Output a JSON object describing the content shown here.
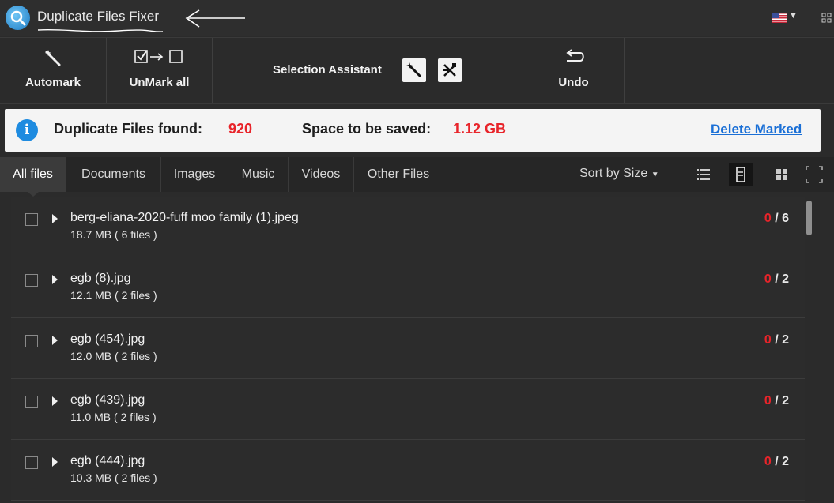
{
  "app": {
    "title": "Duplicate Files Fixer"
  },
  "toolbar": {
    "automark_label": "Automark",
    "unmark_label": "UnMark all",
    "selection_assistant_label": "Selection Assistant",
    "undo_label": "Undo"
  },
  "info": {
    "found_label": "Duplicate Files found:",
    "found_value": "920",
    "space_label": "Space to be saved:",
    "space_value": "1.12 GB",
    "delete_label": "Delete Marked"
  },
  "tabs": [
    {
      "label": "All files",
      "active": true
    },
    {
      "label": "Documents"
    },
    {
      "label": "Images"
    },
    {
      "label": "Music"
    },
    {
      "label": "Videos"
    },
    {
      "label": "Other Files"
    }
  ],
  "sort": {
    "label": "Sort by Size"
  },
  "groups": [
    {
      "name": "berg-eliana-2020-fuff moo family (1).jpeg",
      "meta": "18.7 MB ( 6 files )",
      "marked": "0",
      "total": "/ 6"
    },
    {
      "name": "egb (8).jpg",
      "meta": "12.1 MB ( 2 files )",
      "marked": "0",
      "total": "/ 2"
    },
    {
      "name": "egb (454).jpg",
      "meta": "12.0 MB ( 2 files )",
      "marked": "0",
      "total": "/ 2"
    },
    {
      "name": "egb (439).jpg",
      "meta": "11.0 MB ( 2 files )",
      "marked": "0",
      "total": "/ 2"
    },
    {
      "name": "egb (444).jpg",
      "meta": "10.3 MB ( 2 files )",
      "marked": "0",
      "total": "/ 2"
    }
  ],
  "icons": {
    "logo": "search-magnifier-icon",
    "language": "us-flag-icon",
    "automark": "magic-wand-icon",
    "unmark": "checkbox-arrow-icon",
    "undo": "undo-arrow-icon",
    "view_list": "list-view-icon",
    "view_detail": "detail-view-icon",
    "view_grid": "grid-view-icon",
    "fullscreen": "expand-icon"
  },
  "colors": {
    "accent_red": "#e8242a",
    "link_blue": "#1a6fd6",
    "info_blue": "#1e8be0"
  }
}
